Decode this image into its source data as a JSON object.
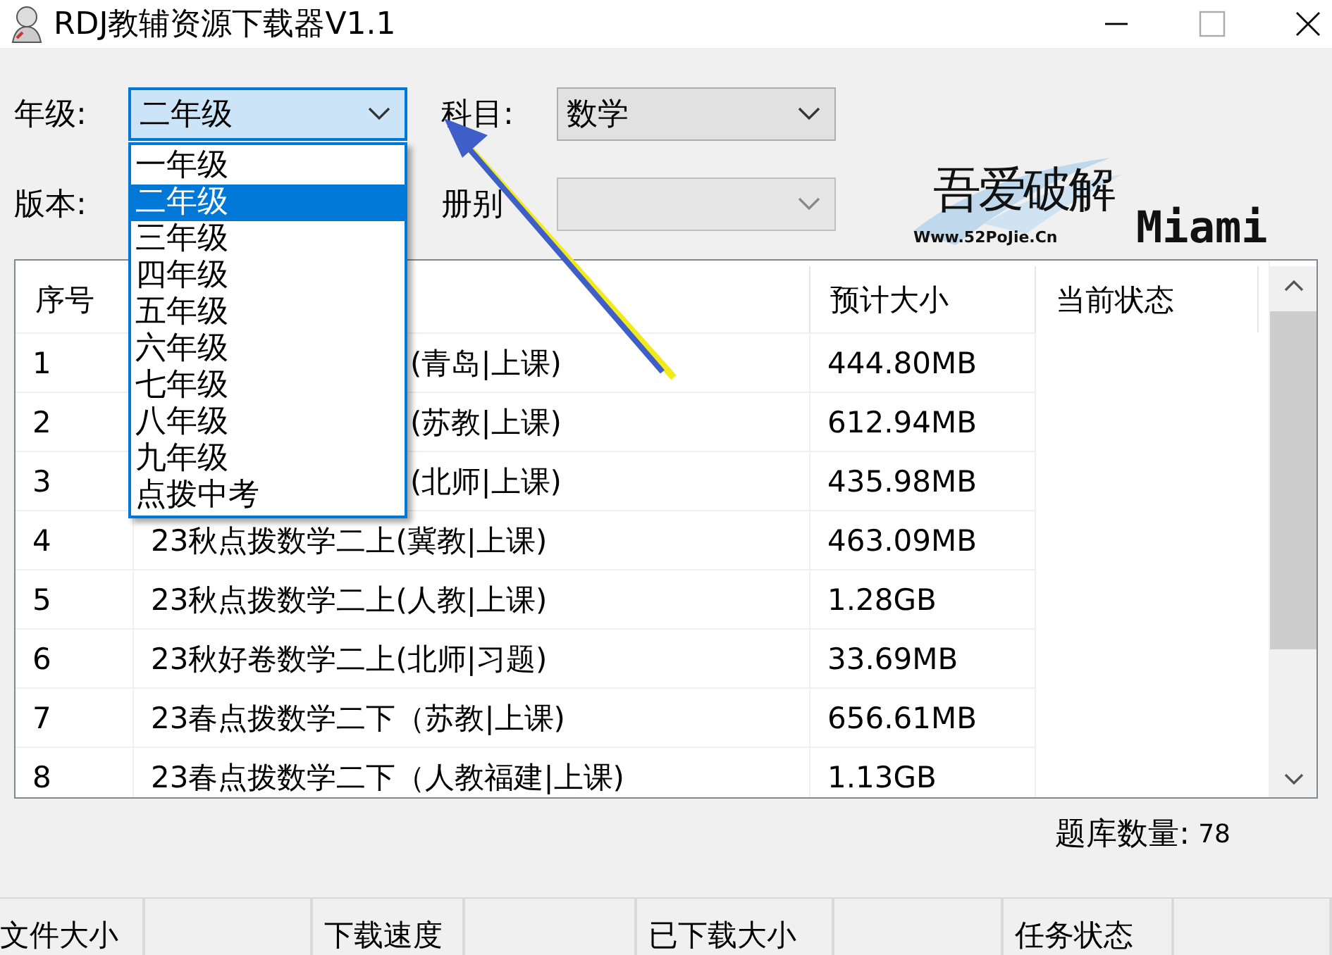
{
  "window": {
    "title": "RDJ教辅资源下载器V1.1"
  },
  "filters": [
    {
      "label": "年级:",
      "value": "二年级",
      "disabled": false,
      "expanded": true
    },
    {
      "label": "科目:",
      "value": "数学",
      "disabled": false,
      "expanded": false
    },
    {
      "label": "版本:"
    },
    {
      "label": "册别",
      "disabled": true,
      "expanded": false
    }
  ],
  "grade_list": [
    {
      "label": "一年级",
      "selected": false
    },
    {
      "label": "二年级",
      "selected": true
    },
    {
      "label": "三年级",
      "selected": false
    },
    {
      "label": "四年级",
      "selected": false
    },
    {
      "label": "五年级",
      "selected": false
    },
    {
      "label": "六年级",
      "selected": false
    },
    {
      "label": "七年级",
      "selected": false
    },
    {
      "label": "八年级",
      "selected": false
    },
    {
      "label": "九年级",
      "selected": false
    },
    {
      "label": "点拨中考",
      "selected": false
    }
  ],
  "logo": {
    "title": "吾爱破解",
    "url": "Www.52PoJie.Cn",
    "tag": "Miami"
  },
  "table": {
    "columns": [
      {
        "label": "序号"
      },
      {},
      {
        "label": "预计大小"
      },
      {
        "label": "当前状态"
      }
    ],
    "rows": [
      {
        "number": "1",
        "name": "(青岛|上课)",
        "covered": true,
        "size": "444.80MB"
      },
      {
        "number": "2",
        "name": "(苏教|上课)",
        "covered": true,
        "size": "612.94MB"
      },
      {
        "number": "3",
        "name": "(北师|上课)",
        "covered": true,
        "size": "435.98MB"
      },
      {
        "number": "4",
        "name": "23秋点拨数学二上(冀教|上课)",
        "covered": false,
        "size": "463.09MB"
      },
      {
        "number": "5",
        "name": "23秋点拨数学二上(人教|上课)",
        "covered": false,
        "size": "1.28GB"
      },
      {
        "number": "6",
        "name": "23秋好卷数学二上(北师|习题)",
        "covered": false,
        "size": "33.69MB"
      },
      {
        "number": "7",
        "name": "23春点拨数学二下（苏教|上课)",
        "covered": false,
        "size": "656.61MB"
      },
      {
        "number": "8",
        "name": "23春点拨数学二下（人教福建|上课)",
        "covered": false,
        "size": "1.13GB"
      }
    ]
  },
  "count": {
    "label": "题库数量:",
    "value": "78"
  },
  "status_bar": [
    "文件大小",
    "下载速度",
    "已下载大小",
    "任务状态"
  ]
}
